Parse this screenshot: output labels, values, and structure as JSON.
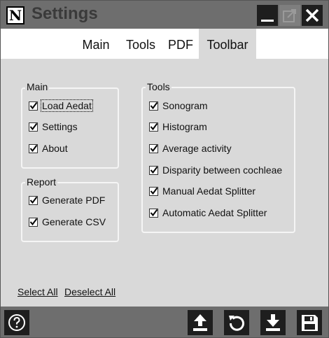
{
  "window": {
    "title": "Settings",
    "logo_letter": "N"
  },
  "tabs": [
    {
      "label": "Main",
      "active": false
    },
    {
      "label": "Tools",
      "active": false
    },
    {
      "label": "PDF",
      "active": false
    },
    {
      "label": "Toolbar",
      "active": true
    }
  ],
  "groups": {
    "main": {
      "title": "Main",
      "items": [
        {
          "label": "Load Aedat",
          "checked": true
        },
        {
          "label": "Settings",
          "checked": true
        },
        {
          "label": "About",
          "checked": true
        }
      ]
    },
    "report": {
      "title": "Report",
      "items": [
        {
          "label": "Generate PDF",
          "checked": true
        },
        {
          "label": "Generate CSV",
          "checked": true
        }
      ]
    },
    "tools": {
      "title": "Tools",
      "items": [
        {
          "label": "Sonogram",
          "checked": true
        },
        {
          "label": "Histogram",
          "checked": true
        },
        {
          "label": "Average activity",
          "checked": true
        },
        {
          "label": "Disparity between cochleae",
          "checked": true
        },
        {
          "label": "Manual Aedat Splitter",
          "checked": true
        },
        {
          "label": "Automatic Aedat Splitter",
          "checked": true
        }
      ]
    }
  },
  "links": {
    "select_all": "Select All",
    "deselect_all": "Deselect All"
  },
  "bottom_bar": {
    "icons": [
      "help-icon",
      "upload-icon",
      "reset-icon",
      "download-icon",
      "save-icon"
    ]
  },
  "colors": {
    "titlebar": "#6e6e6e",
    "button": "#1e1e1e",
    "content_bg": "#d9d9d9",
    "tab_bar": "#ffffff"
  }
}
